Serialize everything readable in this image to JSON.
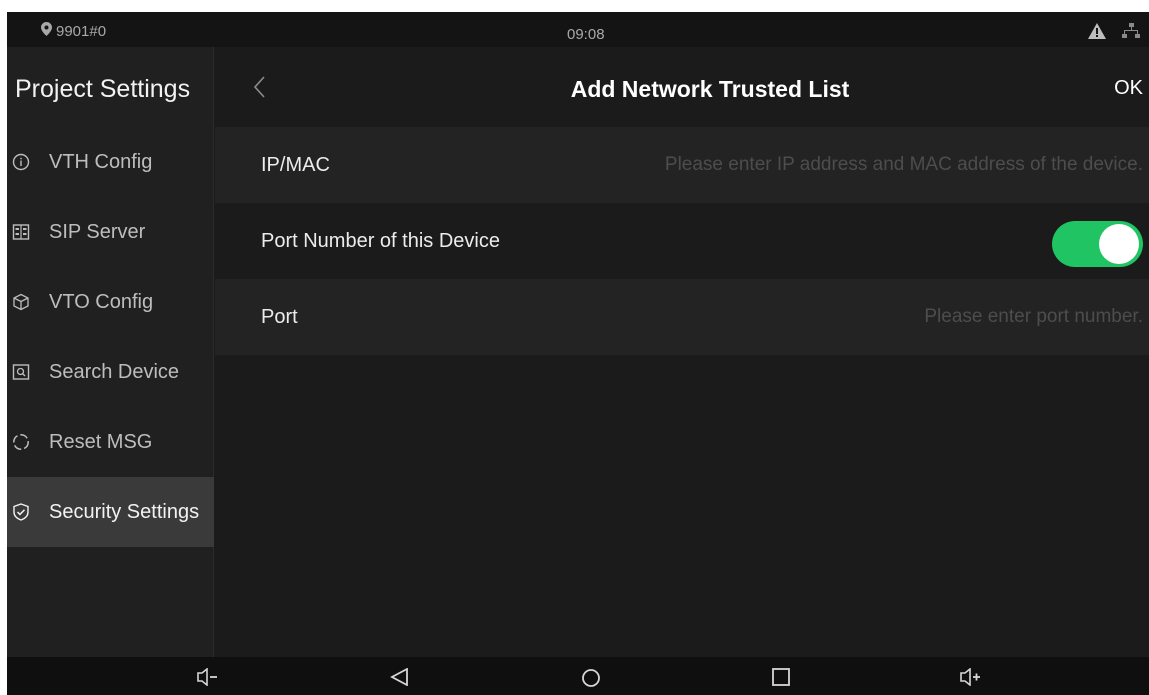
{
  "status_bar": {
    "location": "9901#0",
    "time": "09:08",
    "icons": [
      "location-pin-icon",
      "warning-icon",
      "network-icon"
    ]
  },
  "sidebar": {
    "title": "Project Settings",
    "items": [
      {
        "label": "VTH Config",
        "icon": "info-icon"
      },
      {
        "label": "SIP Server",
        "icon": "server-icon"
      },
      {
        "label": "VTO Config",
        "icon": "cube-icon"
      },
      {
        "label": "Search Device",
        "icon": "search-device-icon"
      },
      {
        "label": "Reset MSG",
        "icon": "reset-icon"
      },
      {
        "label": "Security Settings",
        "icon": "shield-check-icon",
        "active": true
      }
    ]
  },
  "header": {
    "title": "Add Network Trusted List",
    "ok_label": "OK"
  },
  "form": {
    "ip_mac": {
      "label": "IP/MAC",
      "value": "",
      "placeholder": "Please enter IP address and MAC address of the device."
    },
    "port_toggle": {
      "label": "Port Number of this Device",
      "on": true
    },
    "port": {
      "label": "Port",
      "value": "",
      "placeholder": "Please enter port number."
    }
  },
  "nav_bar": {
    "buttons": [
      "volume-down-icon",
      "back-icon",
      "home-icon",
      "recents-icon",
      "volume-up-icon"
    ]
  },
  "colors": {
    "accent_green": "#21c462",
    "background": "#1b1b1b",
    "sidebar_active": "#3a3a3a"
  }
}
